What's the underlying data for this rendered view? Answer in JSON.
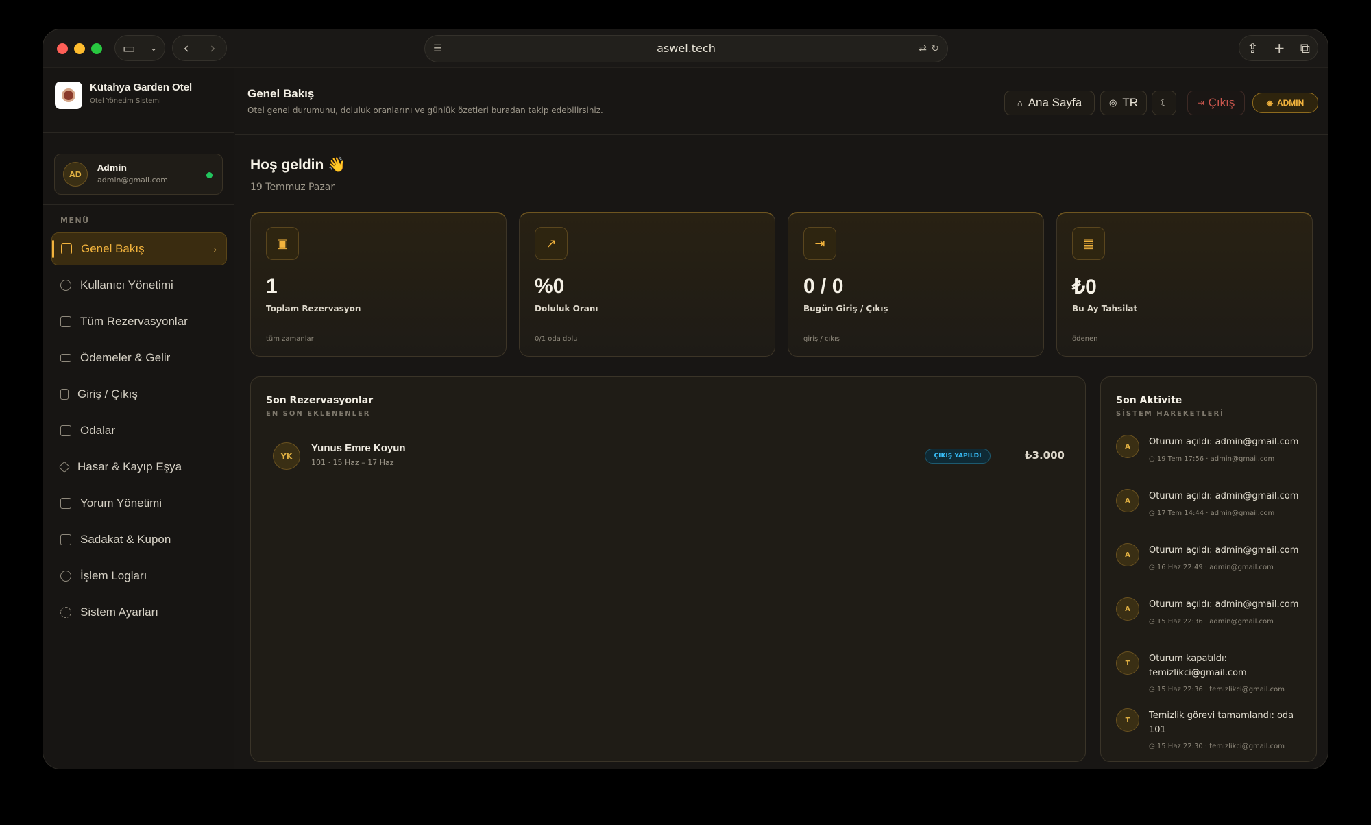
{
  "browser": {
    "url": "aswel.tech"
  },
  "brand": {
    "name": "Kütahya Garden Otel",
    "subtitle": "Otel Yönetim Sistemi"
  },
  "user": {
    "initials": "AD",
    "name": "Admin",
    "email": "admin@gmail.com"
  },
  "sidebar": {
    "menu_label": "MENÜ",
    "items": [
      {
        "label": "Genel Bakış",
        "icon": "grid-icon"
      },
      {
        "label": "Kullanıcı Yönetimi",
        "icon": "users-icon"
      },
      {
        "label": "Tüm Rezervasyonlar",
        "icon": "calendar-icon"
      },
      {
        "label": "Ödemeler & Gelir",
        "icon": "credit-card-icon"
      },
      {
        "label": "Giriş / Çıkış",
        "icon": "door-icon"
      },
      {
        "label": "Odalar",
        "icon": "building-icon"
      },
      {
        "label": "Hasar & Kayıp Eşya",
        "icon": "wrench-icon"
      },
      {
        "label": "Yorum Yönetimi",
        "icon": "comment-icon"
      },
      {
        "label": "Sadakat & Kupon",
        "icon": "gift-icon"
      },
      {
        "label": "İşlem Logları",
        "icon": "log-icon"
      },
      {
        "label": "Sistem Ayarları",
        "icon": "gear-icon"
      }
    ]
  },
  "header": {
    "title": "Genel Bakış",
    "subtitle": "Otel genel durumunu, doluluk oranlarını ve günlük özetleri buradan takip edebilirsiniz.",
    "home": "Ana Sayfa",
    "lang": "TR",
    "logout": "Çıkış",
    "role": "ADMIN"
  },
  "greeting": {
    "title": "Hoş geldin 👋",
    "date": "19 Temmuz Pazar"
  },
  "stats": [
    {
      "value": "1",
      "label": "Toplam Rezervasyon",
      "footer": "tüm zamanlar",
      "icon": "calendar-check-icon"
    },
    {
      "value": "%0",
      "label": "Doluluk Oranı",
      "footer": "0/1 oda dolu",
      "icon": "trending-up-icon"
    },
    {
      "value": "0 / 0",
      "label": "Bugün Giriş / Çıkış",
      "footer": "giriş / çıkış",
      "icon": "login-icon"
    },
    {
      "value": "₺0",
      "label": "Bu Ay Tahsilat",
      "footer": "ödenen",
      "icon": "wallet-icon"
    }
  ],
  "reservations": {
    "title": "Son Rezervasyonlar",
    "subtitle": "EN SON EKLENENLER",
    "items": [
      {
        "initials": "YK",
        "name": "Yunus Emre Koyun",
        "detail": "101  ·  15 Haz – 17 Haz",
        "status": "ÇIKIŞ YAPILDI",
        "amount": "₺3.000"
      }
    ]
  },
  "activity": {
    "title": "Son Aktivite",
    "subtitle": "SİSTEM HAREKETLERİ",
    "items": [
      {
        "initial": "A",
        "text": "Oturum açıldı: admin@gmail.com",
        "meta": "◷  19 Tem 17:56  ·  admin@gmail.com"
      },
      {
        "initial": "A",
        "text": "Oturum açıldı: admin@gmail.com",
        "meta": "◷  17 Tem 14:44  ·  admin@gmail.com"
      },
      {
        "initial": "A",
        "text": "Oturum açıldı: admin@gmail.com",
        "meta": "◷  16 Haz 22:49  ·  admin@gmail.com"
      },
      {
        "initial": "A",
        "text": "Oturum açıldı: admin@gmail.com",
        "meta": "◷  15 Haz 22:36  ·  admin@gmail.com"
      },
      {
        "initial": "T",
        "text": "Oturum kapatıldı: temizlikci@gmail.com",
        "meta": "◷  15 Haz 22:36  ·  temizlikci@gmail.com"
      },
      {
        "initial": "T",
        "text": "Temizlik görevi tamamlandı: oda 101",
        "meta": "◷  15 Haz 22:30  ·  temizlikci@gmail.com"
      }
    ]
  }
}
